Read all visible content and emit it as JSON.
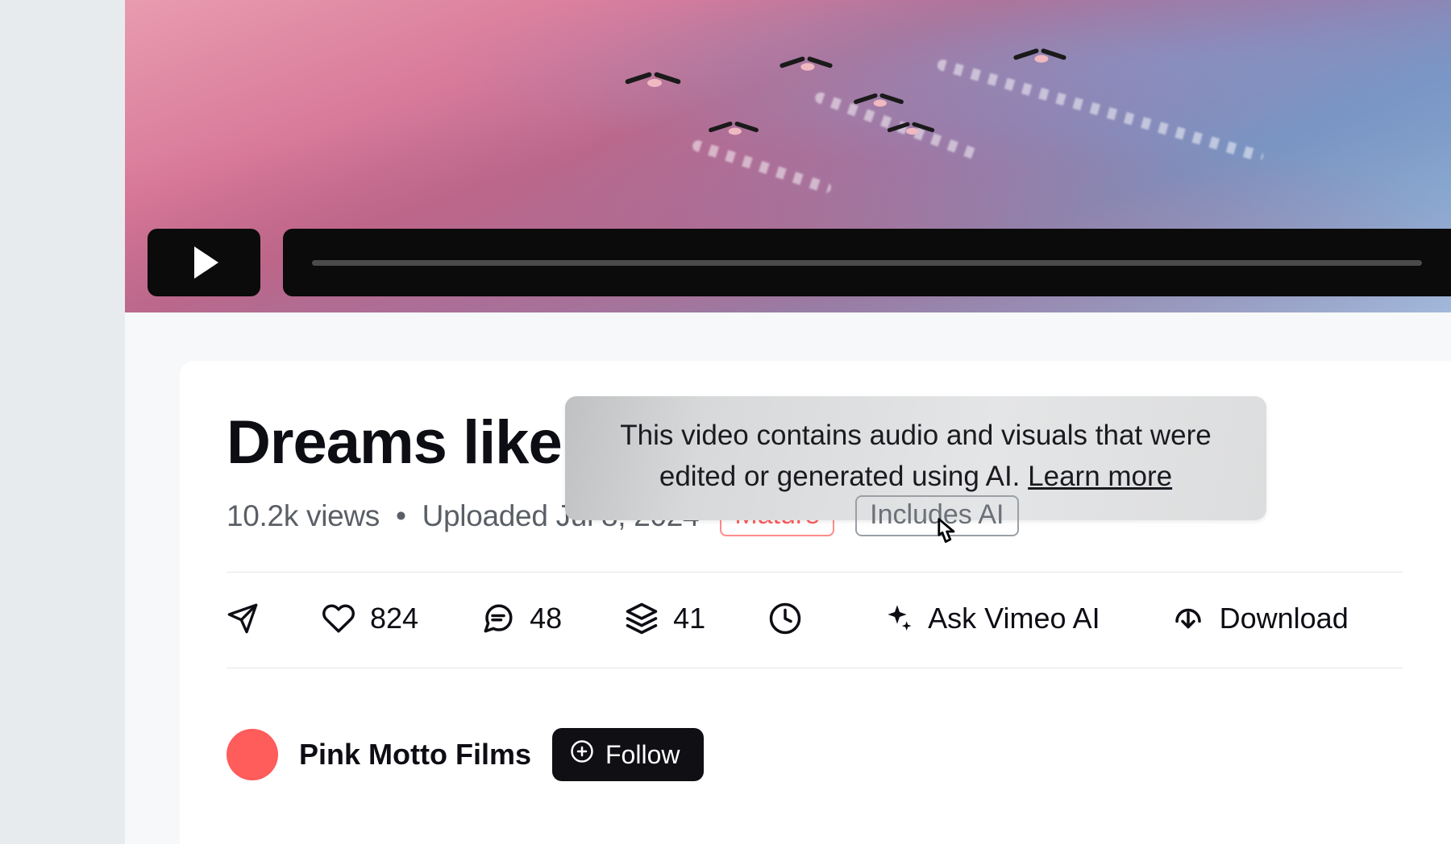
{
  "video": {
    "title": "Dreams like",
    "views_text": "10.2k views",
    "separator": "•",
    "uploaded_text": "Uploaded Jul 8, 2024"
  },
  "badges": {
    "mature": "Mature",
    "ai": "Includes AI"
  },
  "tooltip": {
    "text": "This video contains audio and visuals that were edited or generated using AI. ",
    "link": "Learn more"
  },
  "actions": {
    "likes": "824",
    "comments": "48",
    "collections": "41",
    "ask_ai": "Ask Vimeo AI",
    "download": "Download"
  },
  "channel": {
    "name": "Pink Motto Films",
    "follow": "Follow"
  }
}
